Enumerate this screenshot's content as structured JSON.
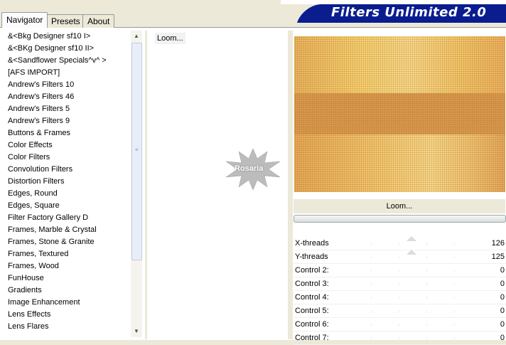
{
  "tabs": [
    {
      "label": "Navigator"
    },
    {
      "label": "Presets"
    },
    {
      "label": "About"
    }
  ],
  "banner": {
    "title": "Filters Unlimited 2.0"
  },
  "filter_list": [
    "&<Bkg Designer sf10 I>",
    "&<BKg Designer sf10 II>",
    "&<Sandflower Specials^v^ >",
    "[AFS IMPORT]",
    "Andrew's Filters 10",
    "Andrew's Filters 46",
    "Andrew's Filters 5",
    "Andrew's Filters 9",
    "Buttons & Frames",
    "Color Effects",
    "Color Filters",
    "Convolution Filters",
    "Distortion Filters",
    "Edges, Round",
    "Edges, Square",
    "Filter Factory Gallery D",
    "Frames, Marble & Crystal",
    "Frames, Stone & Granite",
    "Frames, Textured",
    "Frames, Wood",
    "FunHouse",
    "Gradients",
    "Image Enhancement",
    "Lens Effects",
    "Lens Flares"
  ],
  "selected_category": "FunHouse",
  "filter_items": [
    "Loom..."
  ],
  "logo_text": "Rosaria",
  "apply_button": "Loom...",
  "controls": [
    {
      "label": "X-threads",
      "value": "126",
      "level": 0.49
    },
    {
      "label": "Y-threads",
      "value": "125",
      "level": 0.49
    },
    {
      "label": "Control 2:",
      "value": "0",
      "level": 0
    },
    {
      "label": "Control 3:",
      "value": "0",
      "level": 0
    },
    {
      "label": "Control 4:",
      "value": "0",
      "level": 0
    },
    {
      "label": "Control 5:",
      "value": "0",
      "level": 0
    },
    {
      "label": "Control 6:",
      "value": "0",
      "level": 0
    },
    {
      "label": "Control 7:",
      "value": "0",
      "level": 0
    }
  ],
  "colors": {
    "banner": "#0a1d8f",
    "preview_band": "#d89a4e"
  },
  "icons": {
    "scroll_up": "scroll-up-arrow-icon",
    "scroll_down": "scroll-down-arrow-icon"
  }
}
